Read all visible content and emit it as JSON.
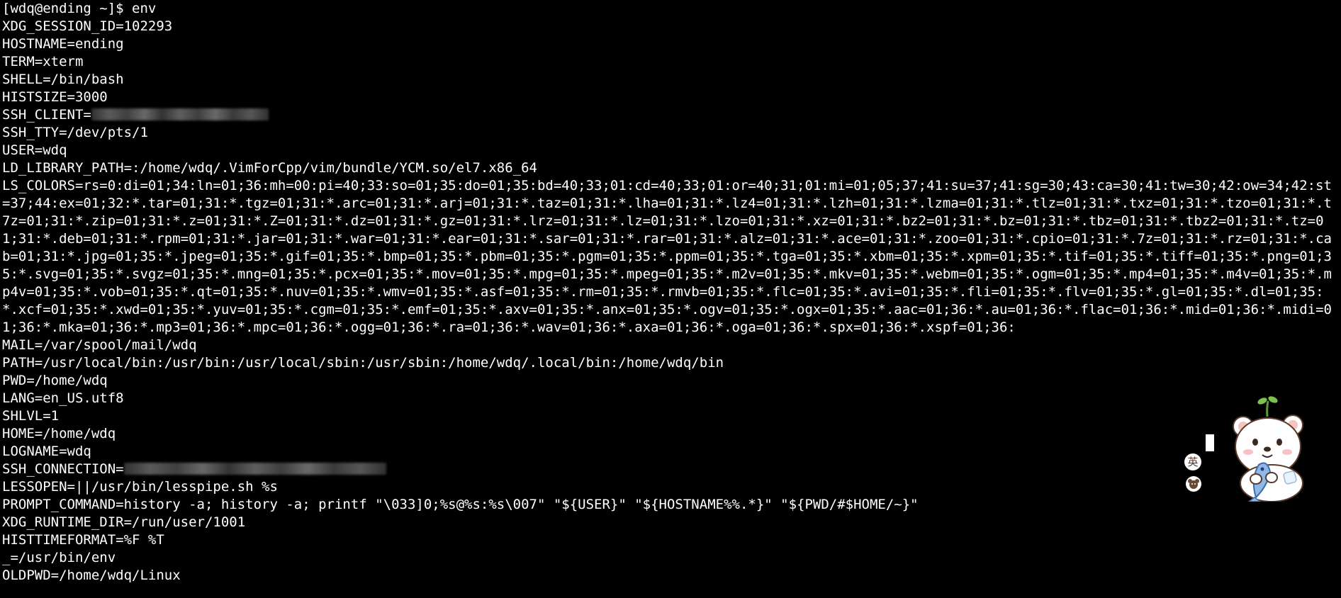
{
  "terminal": {
    "prompt_line": "[wdq@ending ~]$ env",
    "env": {
      "xdg_session_id": "XDG_SESSION_ID=102293",
      "hostname": "HOSTNAME=ending",
      "term": "TERM=xterm",
      "shell": "SHELL=/bin/bash",
      "histsize": "HISTSIZE=3000",
      "ssh_client_label": "SSH_CLIENT=",
      "ssh_tty": "SSH_TTY=/dev/pts/1",
      "user": "USER=wdq",
      "ld_library_path": "LD_LIBRARY_PATH=:/home/wdq/.VimForCpp/vim/bundle/YCM.so/el7.x86_64",
      "ls_colors": "LS_COLORS=rs=0:di=01;34:ln=01;36:mh=00:pi=40;33:so=01;35:do=01;35:bd=40;33;01:cd=40;33;01:or=40;31;01:mi=01;05;37;41:su=37;41:sg=30;43:ca=30;41:tw=30;42:ow=34;42:st=37;44:ex=01;32:*.tar=01;31:*.tgz=01;31:*.arc=01;31:*.arj=01;31:*.taz=01;31:*.lha=01;31:*.lz4=01;31:*.lzh=01;31:*.lzma=01;31:*.tlz=01;31:*.txz=01;31:*.tzo=01;31:*.t7z=01;31:*.zip=01;31:*.z=01;31:*.Z=01;31:*.dz=01;31:*.gz=01;31:*.lrz=01;31:*.lz=01;31:*.lzo=01;31:*.xz=01;31:*.bz2=01;31:*.bz=01;31:*.tbz=01;31:*.tbz2=01;31:*.tz=01;31:*.deb=01;31:*.rpm=01;31:*.jar=01;31:*.war=01;31:*.ear=01;31:*.sar=01;31:*.rar=01;31:*.alz=01;31:*.ace=01;31:*.zoo=01;31:*.cpio=01;31:*.7z=01;31:*.rz=01;31:*.cab=01;31:*.jpg=01;35:*.jpeg=01;35:*.gif=01;35:*.bmp=01;35:*.pbm=01;35:*.pgm=01;35:*.ppm=01;35:*.tga=01;35:*.xbm=01;35:*.xpm=01;35:*.tif=01;35:*.tiff=01;35:*.png=01;35:*.svg=01;35:*.svgz=01;35:*.mng=01;35:*.pcx=01;35:*.mov=01;35:*.mpg=01;35:*.mpeg=01;35:*.m2v=01;35:*.mkv=01;35:*.webm=01;35:*.ogm=01;35:*.mp4=01;35:*.m4v=01;35:*.mp4v=01;35:*.vob=01;35:*.qt=01;35:*.nuv=01;35:*.wmv=01;35:*.asf=01;35:*.rm=01;35:*.rmvb=01;35:*.flc=01;35:*.avi=01;35:*.fli=01;35:*.flv=01;35:*.gl=01;35:*.dl=01;35:*.xcf=01;35:*.xwd=01;35:*.yuv=01;35:*.cgm=01;35:*.emf=01;35:*.axv=01;35:*.anx=01;35:*.ogv=01;35:*.ogx=01;35:*.aac=01;36:*.au=01;36:*.flac=01;36:*.mid=01;36:*.midi=01;36:*.mka=01;36:*.mp3=01;36:*.mpc=01;36:*.ogg=01;36:*.ra=01;36:*.wav=01;36:*.axa=01;36:*.oga=01;36:*.spx=01;36:*.xspf=01;36:",
      "mail": "MAIL=/var/spool/mail/wdq",
      "path": "PATH=/usr/local/bin:/usr/bin:/usr/local/sbin:/usr/sbin:/home/wdq/.local/bin:/home/wdq/bin",
      "pwd": "PWD=/home/wdq",
      "lang": "LANG=en_US.utf8",
      "shlvl": "SHLVL=1",
      "home": "HOME=/home/wdq",
      "logname": "LOGNAME=wdq",
      "ssh_connection_label": "SSH_CONNECTION=",
      "lessopen": "LESSOPEN=||/usr/bin/lesspipe.sh %s",
      "prompt_command": "PROMPT_COMMAND=history -a; history -a; printf \"\\033]0;%s@%s:%s\\007\" \"${USER}\" \"${HOSTNAME%%.*}\" \"${PWD/#$HOME/~}\"",
      "xdg_runtime_dir": "XDG_RUNTIME_DIR=/run/user/1001",
      "histtimeformat": "HISTTIMEFORMAT=%F %T",
      "underscore": "_=/usr/bin/env",
      "oldpwd": "OLDPWD=/home/wdq/Linux"
    }
  },
  "overlay": {
    "ime_icon_char": "英",
    "sticker_icon": "cartoon-bear-holding-fish-icon"
  },
  "colors": {
    "background": "#000000",
    "foreground": "#ffffff"
  }
}
